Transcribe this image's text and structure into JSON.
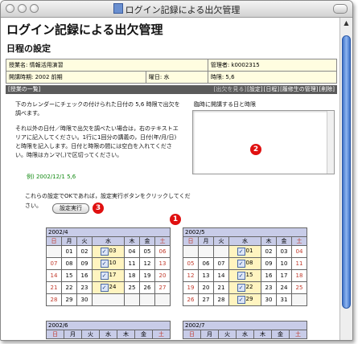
{
  "window": {
    "title": "ログイン記録による出欠管理"
  },
  "page": {
    "title": "ログイン記録による出欠管理",
    "section": "日程の設定"
  },
  "info": {
    "course": "授業名: 情報活用演習",
    "manager": "管理者: k0002315",
    "term": "開講時期: 2002 前期",
    "weekday": "曜日: 水",
    "period": "時限: 5,6"
  },
  "nav": {
    "list": "[授業の一覧]",
    "items": [
      "[出欠を見る]",
      "[設定]",
      "[日程]",
      "[履修生の管理]",
      "[削除]"
    ]
  },
  "instructions": {
    "p1": "下のカレンダーにチェックの付けられた日付の 5,6 時限で出欠を調べます。",
    "p2": "それ以外の日付／時限で出欠を調べたい場合は，右のテキストエリアに記入してください。1行に1回分の講義の，日付(年/月/日) と時限を記入します。日付と時限の間には空白を入れてください。時限はカンマ(,)で区切ってください。",
    "example": "例) 2002/12/1 5,6",
    "textarea_label": "臨時に開講する日と時限",
    "exec_text": "これらの設定でOKであれば，設定実行ボタンをクリックしてください。",
    "exec_button": "設定実行"
  },
  "badges": {
    "one": "1",
    "two": "2",
    "three": "3"
  },
  "weekdays": [
    "日",
    "月",
    "火",
    "水",
    "木",
    "金",
    "土"
  ],
  "calendars": [
    {
      "title": "2002/4",
      "rows": [
        [
          "",
          "01",
          "02",
          "03",
          "04",
          "05",
          "06"
        ],
        [
          "07",
          "08",
          "09",
          "10",
          "11",
          "12",
          "13"
        ],
        [
          "14",
          "15",
          "16",
          "17",
          "18",
          "19",
          "20"
        ],
        [
          "21",
          "22",
          "23",
          "24",
          "25",
          "26",
          "27"
        ],
        [
          "28",
          "29",
          "30",
          "",
          "",
          "",
          ""
        ]
      ],
      "checked": [
        "03",
        "10",
        "17",
        "24"
      ]
    },
    {
      "title": "2002/5",
      "rows": [
        [
          "",
          "",
          "",
          "01",
          "02",
          "03",
          "04"
        ],
        [
          "05",
          "06",
          "07",
          "08",
          "09",
          "10",
          "11"
        ],
        [
          "12",
          "13",
          "14",
          "15",
          "16",
          "17",
          "18"
        ],
        [
          "19",
          "20",
          "21",
          "22",
          "23",
          "24",
          "25"
        ],
        [
          "26",
          "27",
          "28",
          "29",
          "30",
          "31",
          ""
        ]
      ],
      "checked": [
        "01",
        "08",
        "15",
        "22",
        "29"
      ]
    },
    {
      "title": "2002/6",
      "rows": [],
      "checked": []
    },
    {
      "title": "2002/7",
      "rows": [],
      "checked": []
    }
  ],
  "colors": {
    "accent": "#e01010",
    "nav_bg": "#5b5b5b",
    "cal_header": "#c8cce8",
    "info_bg": "#fffde0"
  }
}
